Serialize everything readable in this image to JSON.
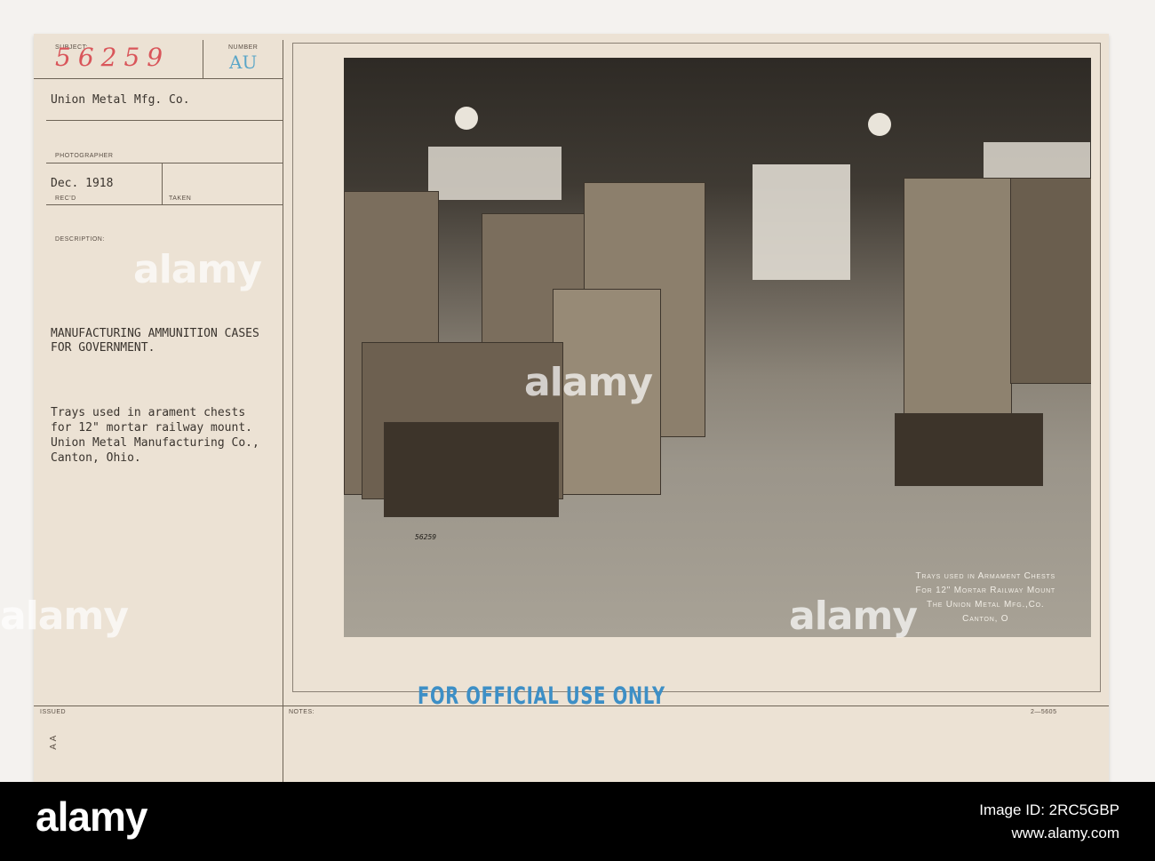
{
  "card": {
    "subject_label": "SUBJECT:",
    "subject_number": "56259",
    "number_label": "NUMBER",
    "number_value": "AU",
    "company": "Union Metal Mfg. Co.",
    "photographer_label": "PHOTOGRAPHER",
    "date": "Dec. 1918",
    "recd_label": "REC'D",
    "taken_label": "TAKEN",
    "description_label": "DESCRIPTION:",
    "description_title": "MANUFACTURING AMMUNITION CASES\nFOR GOVERNMENT.",
    "description_body": "Trays used in arament chests\nfor 12\" mortar railway mount.\nUnion Metal Manufacturing Co.,\nCanton, Ohio.",
    "issued_label": "ISSUED",
    "notes_label": "NOTES:",
    "form_number": "2—5605",
    "stamp": "FOR OFFICIAL USE ONLY",
    "margin_marks": "A A"
  },
  "photo": {
    "negative_number": "56259",
    "caption": [
      "Trays used in Armament Chests",
      "For 12\" Mortar Railway Mount",
      "The Union Metal Mfg.,Co.",
      "Canton, O"
    ]
  },
  "watermark": "alamy",
  "footer": {
    "logo": "alamy",
    "image_id": "Image ID: 2RC5GBP",
    "url": "www.alamy.com"
  }
}
